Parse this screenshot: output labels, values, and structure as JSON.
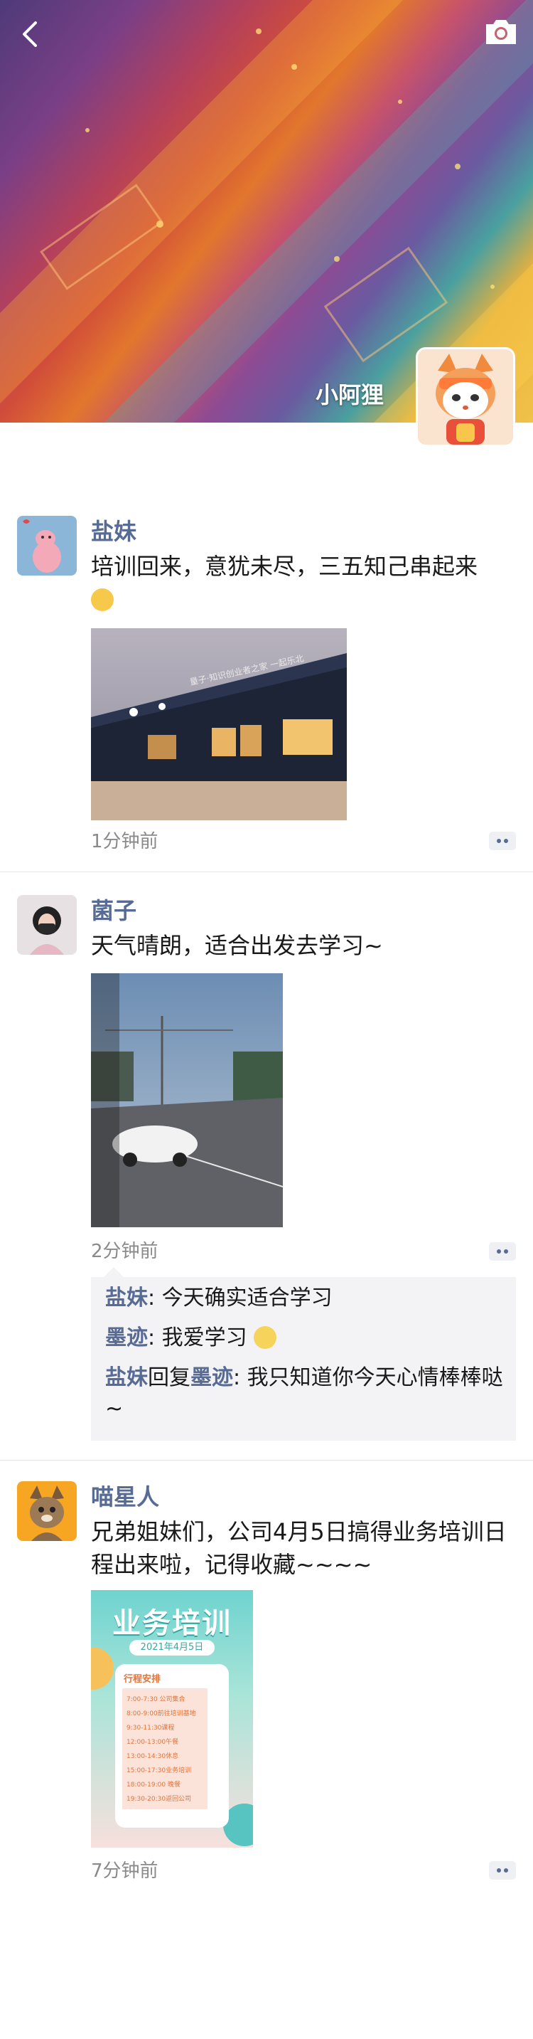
{
  "header": {
    "back_icon": "chevron-left-icon",
    "camera_icon": "camera-icon",
    "user_name": "小阿狸",
    "cover_colors": [
      "#7a3f86",
      "#d14d3a",
      "#4aa0a0",
      "#f0c24a"
    ]
  },
  "posts": [
    {
      "author": "盐妹",
      "text": "培训回来，意犹未尽，三五知己串起来",
      "emoji": "squinting-face-icon",
      "photo_sign": "量子·知识创业者之家 一起乐北",
      "time": "1分钟前"
    },
    {
      "author": "菌子",
      "text": "天气晴朗，适合出发去学习~",
      "time": "2分钟前",
      "comments": [
        {
          "name": "盐妹",
          "sep": ": ",
          "text": "今天确实适合学习"
        },
        {
          "name": "墨迹",
          "sep": ": ",
          "text": "我爱学习"
        },
        {
          "name": "盐妹",
          "reply_word": "回复",
          "reply_to": "墨迹",
          "sep": ": ",
          "text": "我只知道你今天心情棒棒哒~"
        }
      ]
    },
    {
      "author": "喵星人",
      "text": "兄弟姐妹们，公司4月5日搞得业务培训日程出来啦，记得收藏~~~~",
      "time": "7分钟前",
      "poster": {
        "title": "业务培训",
        "date": "2021年4月5日",
        "section": "行程安排",
        "rows": [
          "7:00-7:30 公司集合",
          "8:00-9:00前往培训基地",
          "9:30-11:30课程",
          "12:00-13:00午餐",
          "13:00-14:30休息",
          "15:00-17:30业务培训",
          "18:00-19:00 晚餐",
          "19:30-20:30返回公司"
        ]
      }
    }
  ]
}
